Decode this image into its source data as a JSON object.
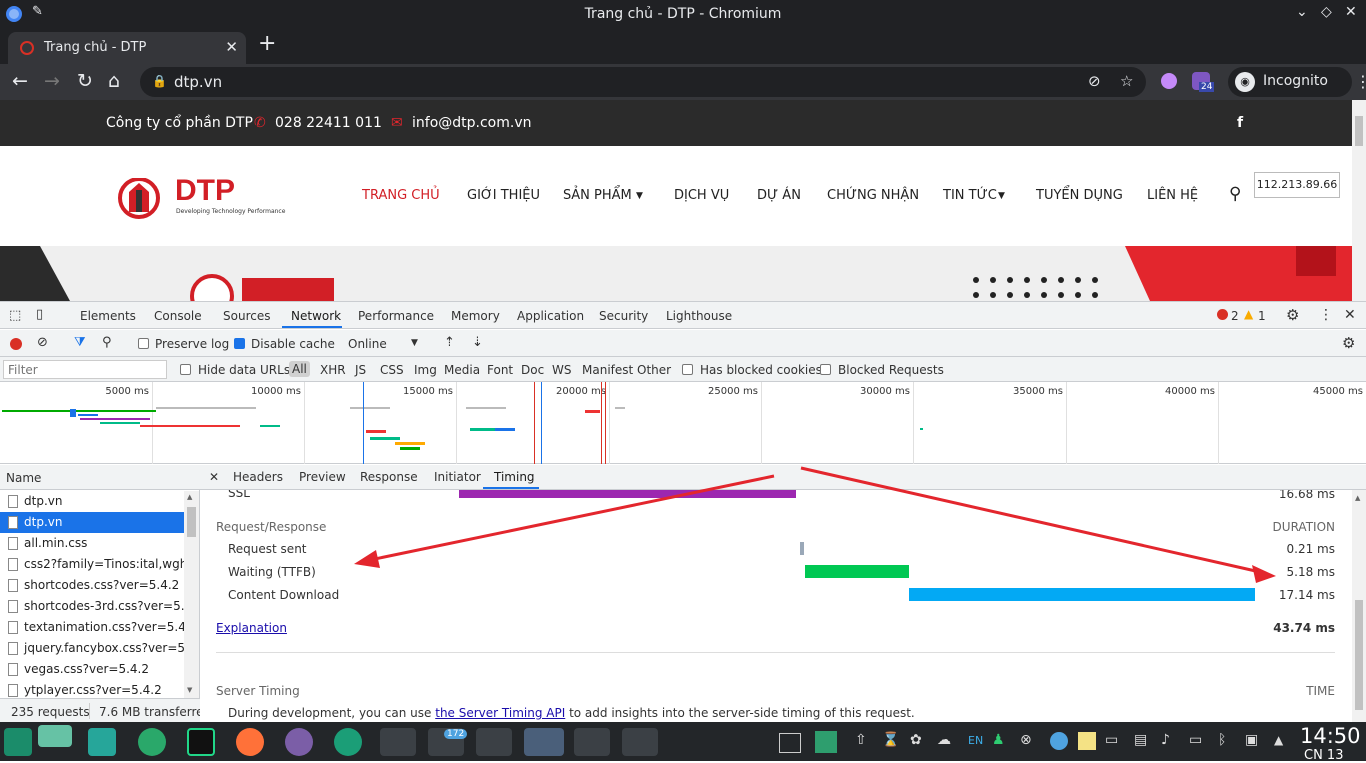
{
  "window": {
    "title": "Trang chủ - DTP - Chromium"
  },
  "tab": {
    "title": "Trang chủ - DTP"
  },
  "omnibox": {
    "url": "dtp.vn",
    "extension_badge": "24",
    "profile_label": "Incognito"
  },
  "site": {
    "company": "Công ty cổ phần DTP",
    "phone": "028 22411 011",
    "email": "info@dtp.com.vn",
    "logo_text": "DTP",
    "logo_tagline": "Developing Technology Performance",
    "menu": [
      "TRANG CHỦ",
      "GIỚI THIỆU",
      "SẢN PHẨM",
      "DỊCH VỤ",
      "DỰ ÁN",
      "CHỨNG NHẬN",
      "TIN TỨC",
      "TUYỂN DỤNG",
      "LIÊN HỆ"
    ],
    "ip_tooltip": "112.213.89.66"
  },
  "devtools": {
    "tabs": [
      "Elements",
      "Console",
      "Sources",
      "Network",
      "Performance",
      "Memory",
      "Application",
      "Security",
      "Lighthouse"
    ],
    "active_tab": "Network",
    "errors": "2",
    "warnings": "1",
    "toolbar": {
      "preserve_log": "Preserve log",
      "disable_cache": "Disable cache",
      "throttle": "Online"
    },
    "filter": {
      "placeholder": "Filter",
      "hide_data_urls": "Hide data URLs",
      "types": [
        "All",
        "XHR",
        "JS",
        "CSS",
        "Img",
        "Media",
        "Font",
        "Doc",
        "WS",
        "Manifest",
        "Other"
      ],
      "has_blocked_cookies": "Has blocked cookies",
      "blocked_requests": "Blocked Requests"
    },
    "overview_ticks": [
      "5000 ms",
      "10000 ms",
      "15000 ms",
      "20000 ms",
      "25000 ms",
      "30000 ms",
      "35000 ms",
      "40000 ms",
      "45000 ms"
    ],
    "name_header": "Name",
    "requests": [
      {
        "name": "dtp.vn"
      },
      {
        "name": "dtp.vn"
      },
      {
        "name": "all.min.css"
      },
      {
        "name": "css2?family=Tinos:ital,wght…"
      },
      {
        "name": "shortcodes.css?ver=5.4.2"
      },
      {
        "name": "shortcodes-3rd.css?ver=5.4.2"
      },
      {
        "name": "textanimation.css?ver=5.4.2"
      },
      {
        "name": "jquery.fancybox.css?ver=5.4.2"
      },
      {
        "name": "vegas.css?ver=5.4.2"
      },
      {
        "name": "ytplayer.css?ver=5.4.2"
      }
    ],
    "status": {
      "requests": "235 requests",
      "transferred": "7.6 MB transferred"
    },
    "detail_tabs": [
      "Headers",
      "Preview",
      "Response",
      "Initiator",
      "Timing"
    ],
    "timing": {
      "ssl_label": "SSL",
      "ssl_value": "16.68 ms",
      "section": "Request/Response",
      "duration_header": "DURATION",
      "rows": [
        {
          "label": "Request sent",
          "value": "0.21 ms"
        },
        {
          "label": "Waiting (TTFB)",
          "value": "5.18 ms"
        },
        {
          "label": "Content Download",
          "value": "17.14 ms"
        }
      ],
      "explanation": "Explanation",
      "total": "43.74 ms",
      "server_timing": "Server Timing",
      "time_header": "TIME",
      "note_pre": "During development, you can use ",
      "note_link": "the Server Timing API",
      "note_post": " to add insights into the server-side timing of this request."
    }
  },
  "taskbar": {
    "telegram_badge": "172",
    "lang": "EN",
    "time": "14:50",
    "date": "CN 13"
  }
}
